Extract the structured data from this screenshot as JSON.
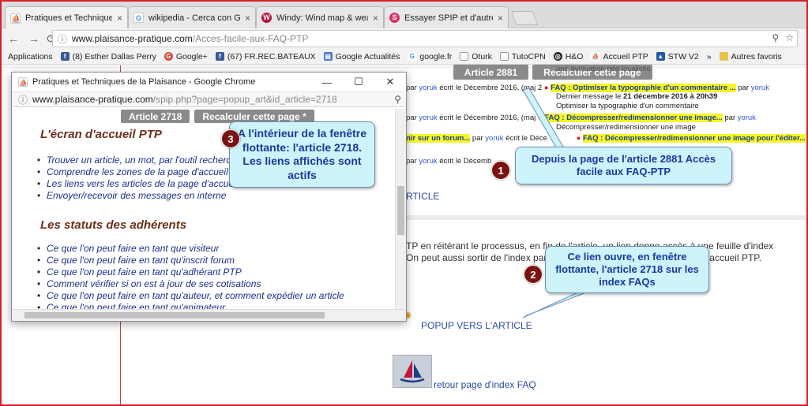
{
  "tabs": [
    {
      "title": "Pratiques et Techniques de la Plaisance",
      "icon": "ptp-favicon",
      "active": true
    },
    {
      "title": "wikipedia - Cerca con Google",
      "icon": "google-favicon"
    },
    {
      "title": "Windy: Wind map & weather forecast",
      "icon": "windy-favicon"
    },
    {
      "title": "Essayer SPIP et d'autres CMS",
      "icon": "spip-favicon"
    }
  ],
  "address_bar": {
    "host": "www.plaisance-pratique.com",
    "path": "/Acces-facile-aux-FAQ-PTP"
  },
  "bookmarks": [
    {
      "label": "Applications",
      "icon": ""
    },
    {
      "label": "(8) Esther Dallas Perry",
      "icon": "facebook-icon"
    },
    {
      "label": "Google+",
      "icon": "google-plus-icon"
    },
    {
      "label": "(67) FR.REC.BATEAUX",
      "icon": "facebook-icon"
    },
    {
      "label": "Google Actualités",
      "icon": "news-icon"
    },
    {
      "label": "google.fr",
      "icon": "google-icon"
    },
    {
      "label": "Oturk",
      "icon": "page-icon"
    },
    {
      "label": "TutoCPN",
      "icon": "page-icon"
    },
    {
      "label": "H&O",
      "icon": "ho-icon"
    },
    {
      "label": "Accueil PTP",
      "icon": "ptp-icon"
    },
    {
      "label": "STW V2",
      "icon": "stw-icon"
    },
    {
      "label": "»",
      "icon": ""
    },
    {
      "label": "Autres favoris",
      "icon": "folder-icon"
    }
  ],
  "page": {
    "article_button": "Article 2881",
    "recalc_button": "Recalculer cette page",
    "lines": {
      "l0": "une évaluation géo localisée",
      "l1a": "par",
      "l1b": "yoruk",
      "l1c": "écrit le Décembre 2016, (maj 2",
      "l1d": "FAQ : Optimiser la typographie d'un commentaire ...",
      "l1e": "par",
      "l1f": "yoruk",
      "l2": "Dernier message le",
      "l2b": "21 décembre 2016 à 20h39",
      "l3": "Optimiser la typographie d'un commentaire",
      "l4a": "par",
      "l4b": "yoruk",
      "l4c": "écrit le Décembre 2016, (maj",
      "l4d": "FAQ : Décompresser/redimensionner une image...",
      "l4e": "par",
      "l4f": "yoruk",
      "l5": "Décompresser/redimensionner une image",
      "l6a": "nir sur un forum...",
      "l6b": "par",
      "l6c": "yoruk",
      "l6d": "écrit le Déce",
      "l6e": "FAQ : Décompresser/redimensionner une image pour l'éditer...",
      "l6f": "par",
      "l6g": "yoruk",
      "l7a": "par",
      "l7b": "yoruk",
      "l7c": "écrit le Décemb",
      "l7d": "par",
      "l7e": "yoruk",
      "l8": "RTICLE"
    },
    "para1": "TP en réitérant le processus, en fin de l'article, un lien donne accès à une feuille d'index",
    "para2": "On peut aussi sortir de l'index par",
    "para2b": "rs l'accueil PTP.",
    "popup_link": "POPUP VERS L'ARTICLE",
    "back_link": "retour page d'index FAQ"
  },
  "callouts": {
    "c1_num": "1",
    "c1_text": "Depuis la page de l'article 2881 Accès facile aux FAQ-PTP",
    "c2_num": "2",
    "c2_text": "Ce lien ouvre, en fenêtre flottante, l'article 2718 sur les index FAQs",
    "c3_num": "3",
    "c3_text": "A l'intérieur de la fenêtre flottante: l'article 2718. Les liens affichés sont actifs"
  },
  "popup": {
    "title": "Pratiques et Techniques de la Plaisance - Google Chrome",
    "url_host": "www.plaisance-pratique.com",
    "url_path": "/spip.php?page=popup_art&id_article=2718",
    "article_button": "Article 2718",
    "recalc_button": "Recalculer cette page *",
    "section1_title": "L'écran d'accueil PTP",
    "section1_items": [
      "Trouver un article, un mot, par l'outil recherche",
      "Comprendre les zones de la page d'accueil",
      "Les liens vers les articles de la page d'accueil",
      "Envoyer/recevoir des messages en interne"
    ],
    "section2_title": "Les statuts des adhérents",
    "section2_items": [
      "Ce que l'on peut faire en tant que visiteur",
      "Ce que l'on peut faire en tant qu'inscrit forum",
      "Ce que l'on peut faire en tant qu'adhérant PTP",
      "Comment vérifier si on est à jour de ses cotisations",
      "Ce que l'on peut faire en tant qu'auteur, et comment expédier un article",
      "Ce que l'on peut faire en tant qu'animateur"
    ]
  },
  "colors": {
    "frame": "#d8202a",
    "callout_bg": "#cdf3fb",
    "callout_text": "#163a9a",
    "highlight": "#f6f62a",
    "badge": "#7a1212"
  }
}
